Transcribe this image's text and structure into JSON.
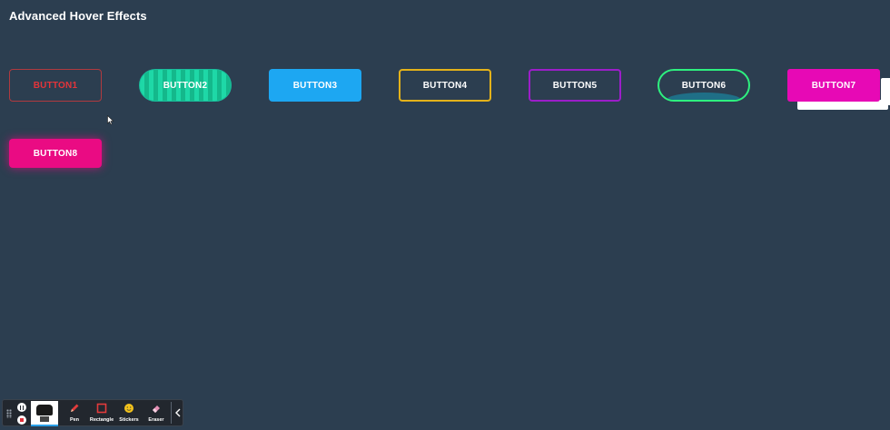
{
  "page": {
    "title": "Advanced Hover Effects"
  },
  "buttons": [
    {
      "label": "BUTTON1"
    },
    {
      "label": "BUTTON2"
    },
    {
      "label": "BUTTON3"
    },
    {
      "label": "BUTTON4"
    },
    {
      "label": "BUTTON5"
    },
    {
      "label": "BUTTON6"
    },
    {
      "label": "BUTTON7"
    },
    {
      "label": "BUTTON8"
    }
  ],
  "toolbar": {
    "tools": [
      {
        "label": "Pen",
        "icon": "pen-icon"
      },
      {
        "label": "Rectangle",
        "icon": "rectangle-icon"
      },
      {
        "label": "Stickers",
        "icon": "sticker-icon"
      },
      {
        "label": "Eraser",
        "icon": "eraser-icon"
      }
    ]
  },
  "colors": {
    "background": "#2c3e50",
    "button1": "#e5343a",
    "button2": "#1ed8a7",
    "button3": "#1da7f2",
    "button4": "#e4b21a",
    "button5": "#9c1ec9",
    "button6": "#2ef07f",
    "button7": "#e709b5",
    "button8": "#ea0b83"
  }
}
